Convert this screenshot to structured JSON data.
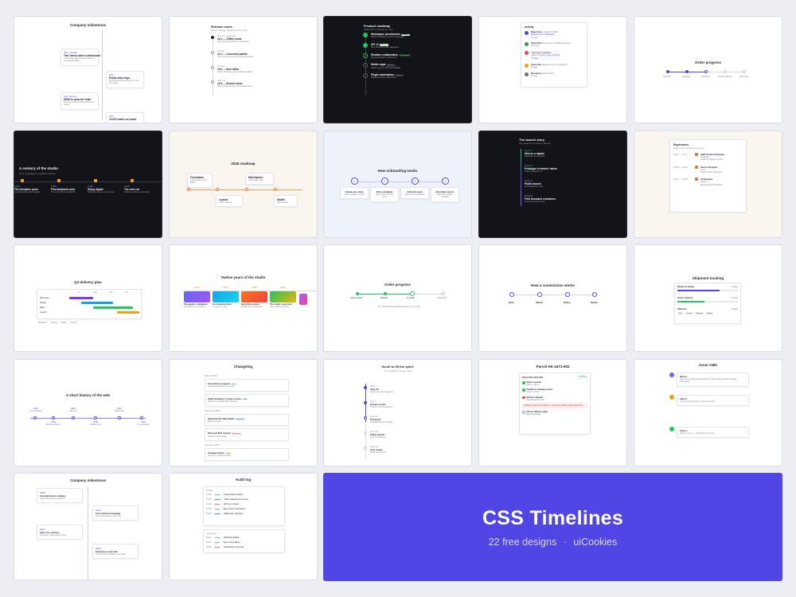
{
  "cards": {
    "c1": {
      "title": "Company milestones",
      "items": [
        {
          "date": "2014 · Founded",
          "title": "Two interns start a whiteboard",
          "text": "A notebook and a shared laptop in a borrowed office"
        },
        {
          "date": "2016",
          "title": "Public beta ships",
          "text": "Four thousand people join in the first week"
        },
        {
          "date": "2019 · Series A",
          "title": "$20M to grow the team",
          "text": "Opened our first office across the ocean"
        },
        {
          "date": "2023",
          "title": "10,000 teams on board",
          "text": "Customers in more than sixty countries"
        }
      ]
    },
    "c2": {
      "title": "Release notes",
      "sub": "Every change, shipped in the open",
      "items": [
        {
          "date": "Nov 12 · Release",
          "title": "v4.2 — Offline mode",
          "text": "Keep working without a connection"
        },
        {
          "date": "Oct 30",
          "title": "v4.1 — Command palette",
          "text": "Jump to any screen from the keyboard"
        },
        {
          "date": "Oct 02",
          "title": "v4.0 — New editor",
          "text": "Faster rendering and a cleaner toolbar"
        },
        {
          "date": "Sep 18",
          "title": "v3.9 — Shared views",
          "text": "Send a filtered view to the whole team"
        }
      ]
    },
    "c3": {
      "title": "Product roadmap",
      "sub": "What we're working on next",
      "items": [
        {
          "title": "Workspace permissions",
          "tag": "Shipped",
          "text": "Roles for editors, viewers and guests"
        },
        {
          "title": "API v2",
          "tag": "Shipped",
          "text": "New endpoints with pagination"
        },
        {
          "title": "Realtime collaboration",
          "tag": "In progress",
          "text": "See teammates' cursors live"
        },
        {
          "title": "Mobile apps",
          "tag": "Planned",
          "text": "Native apps for iOS and Android"
        },
        {
          "title": "Plugin marketplace",
          "tag": "Planned",
          "text": "Build and share integrations"
        }
      ]
    },
    "c4": {
      "title": "Activity",
      "items": [
        {
          "who": "Maya Chen",
          "what": "merged PR #482",
          "text": "Refactor auth middleware",
          "time": "2m ago"
        },
        {
          "who": "Omar Silva",
          "what": "commented on Billing redesign",
          "text": "",
          "time": "14m ago"
        },
        {
          "who": "",
          "what": "New bug in checkout",
          "text": "Payment button stays disabled",
          "time": "1h ago"
        },
        {
          "who": "Grace Kim",
          "what": "deployed v4.2 to production",
          "text": "",
          "time": "3h ago"
        },
        {
          "who": "Bot deploy",
          "what": "build passed",
          "text": "",
          "time": "5h ago"
        }
      ]
    },
    "c5": {
      "title": "Order progress",
      "steps": [
        "Ordered",
        "Shipping",
        "Delivered",
        "Out for delivery",
        "Returned"
      ]
    },
    "c6": {
      "title": "A century of the studio",
      "sub": "From a garage to a global practice",
      "items": [
        {
          "year": "1925",
          "title": "The formative years",
          "text": "A small drafting room opens"
        },
        {
          "year": "1955",
          "title": "First landmark work",
          "text": "The civic hall is completed"
        },
        {
          "year": "1990",
          "title": "Going digital",
          "text": "Drawings move to the screen"
        },
        {
          "year": "2025",
          "title": "The next era",
          "text": "Studios on three continents"
        }
      ]
    },
    "c7": {
      "title": "2026 roadmap",
      "items": [
        {
          "title": "Foundation",
          "text": "Core platform and billing"
        },
        {
          "title": "Launch",
          "text": "Public release"
        },
        {
          "title": "Marketplace",
          "text": "Third-party apps"
        },
        {
          "title": "Mobile",
          "text": "Native apps"
        }
      ]
    },
    "c8": {
      "title": "How onboarding works",
      "items": [
        {
          "n": "1",
          "title": "Create your team",
          "text": "Invite people by email"
        },
        {
          "n": "2",
          "title": "Pick a template",
          "text": "Start from a proven setup"
        },
        {
          "n": "3",
          "title": "Invite the team",
          "text": "Share the workspace"
        },
        {
          "n": "4",
          "title": "Automate reports",
          "text": "Schedule weekly updates"
        }
      ]
    },
    "c9": {
      "title": "The launch story",
      "sub": "Six weeks from idea to launch",
      "items": [
        {
          "date": "Week 1",
          "title": "Idea on a napkin",
          "text": "Sketched the first flow"
        },
        {
          "date": "Week 2",
          "title": "Prototype in testers' hands",
          "text": "Twenty people try it"
        },
        {
          "date": "Week 4",
          "title": "Public launch",
          "text": "Front page for a day"
        },
        {
          "date": "Week 6",
          "title": "First thousand customers",
          "text": "Revenue covers costs"
        }
      ]
    },
    "c10": {
      "title": "Experience",
      "sub": "Eight years building products",
      "items": [
        {
          "date": "2021 — Now",
          "title": "Staff Product Designer",
          "org": "Northwind",
          "text": "Leads the design system"
        },
        {
          "date": "2018 — 2021",
          "title": "Senior Designer",
          "org": "Acme",
          "text": "Shipped the mobile app"
        },
        {
          "date": "2016 — 2018",
          "title": "UI Designer",
          "org": "Globex",
          "text": "Redesigned onboarding"
        }
      ]
    },
    "c11": {
      "title": "Q3 delivery plan",
      "rows": [
        "Discovery",
        "Design",
        "Build",
        "Launch"
      ],
      "months": [
        "Jul",
        "Aug",
        "Sep",
        "Oct"
      ],
      "legend": [
        "Research",
        "Design",
        "Build",
        "Launch"
      ]
    },
    "c12": {
      "title": "Twelve years of the studio",
      "items": [
        {
          "year": "2014",
          "title": "The garden, reimagined",
          "text": "First public commission"
        },
        {
          "year": "2017",
          "title": "First national client",
          "text": "A museum wing"
        },
        {
          "year": "2020",
          "title": "Everything remote",
          "text": "Studio goes distributed"
        },
        {
          "year": "2023",
          "title": "The studio's new chief",
          "text": "New creative director"
        }
      ]
    },
    "c13": {
      "title": "Order progress",
      "steps": [
        "Order placed",
        "Packed",
        "In transit",
        "Delivered"
      ],
      "text": "Your order left our warehouse and is on its way."
    },
    "c14": {
      "title": "How a commission works",
      "steps": [
        "Brief",
        "Sketch",
        "Refine",
        "Deliver"
      ]
    },
    "c15": {
      "title": "Shipment tracking",
      "sections": [
        {
          "label": "Ready for pickup",
          "right": "Details"
        },
        {
          "label": "Out for delivery",
          "right": "Details"
        },
        {
          "label": "Delivered",
          "right": "Details"
        }
      ],
      "chips": [
        "Paid",
        "Packed",
        "Shipped",
        "Signed"
      ]
    },
    "c16": {
      "title": "A short history of the web",
      "items": [
        {
          "year": "1991",
          "title": "First website"
        },
        {
          "year": "1993",
          "title": "Mosaic browser"
        },
        {
          "year": "2004",
          "title": "Web 2.0"
        },
        {
          "year": "2008",
          "title": "Mobile web"
        },
        {
          "year": "2015",
          "title": "ES6 lands"
        },
        {
          "year": "2024",
          "title": "AI assistants"
        }
      ]
    },
    "c17": {
      "title": "Changelog",
      "items": [
        {
          "date": "March 2025",
          "title": "Scroll-driven progress",
          "tag": "New",
          "text": "Animate the rail as you scroll"
        },
        {
          "date": "",
          "title": "Sticky headings on large screens",
          "tag": "New",
          "text": "Dates stay pinned while reading"
        },
        {
          "date": "February 2025",
          "title": "Reworked the dark palette",
          "tag": "Improved",
          "text": "Better contrast"
        },
        {
          "date": "",
          "title": "Removed IE11 support",
          "tag": "Removed",
          "text": "Smaller CSS bundle"
        },
        {
          "date": "January 2025",
          "title": "Grouped entries",
          "tag": "Fixed",
          "text": "Group by month or week"
        }
      ]
    },
    "c18": {
      "title": "Scroll to fill the spine",
      "sub": "The rail fills in as you read",
      "items": [
        {
          "date": "Day 1",
          "title": "Kick-off",
          "text": "Goals and scope agreed"
        },
        {
          "date": "Day 5",
          "title": "Design system",
          "text": "Tokens and components"
        },
        {
          "date": "Day 12",
          "title": "Prototype",
          "text": "Clickable flow for testing"
        },
        {
          "date": "Day 20",
          "title": "Public launch",
          "text": "Live for everyone"
        },
        {
          "date": "Day 30",
          "title": "First review",
          "text": "What we learned"
        }
      ]
    },
    "c19": {
      "title": "Parcel HK-4471-902",
      "badge": "In transit",
      "items": [
        {
          "title": "Order received",
          "text": "Mar 3 · 09:14"
        },
        {
          "title": "Handed to shipping carrier",
          "text": "Mar 3 · 16:02"
        },
        {
          "title": "Delivery delayed",
          "text": "Weather at the hub"
        },
        {
          "title": "Out for delivery again",
          "text": "Expected today"
        }
      ],
      "alert": "Address could not be found — the carrier will try again tomorrow."
    },
    "c20": {
      "title": "Issue #482",
      "items": [
        {
          "who": "Maya K",
          "text": "The export button breaks when the file name contains unicode characters."
        },
        {
          "who": "Omar S",
          "text": "I can reproduce this on the latest build."
        },
        {
          "who": "Grace L",
          "text": "Fixed in v4.2.1 — thanks for the report."
        }
      ]
    },
    "c21": {
      "title": "Company milestones",
      "items": [
        {
          "date": "2008",
          "title": "Founded above a bakery",
          "text": "Three friends and one idea"
        },
        {
          "date": "2012",
          "title": "First national campaign",
          "text": "Our work reaches every city"
        },
        {
          "date": "2017",
          "title": "Sixty-one sections",
          "text": "The team grows across floors"
        },
        {
          "date": "2022",
          "title": "Employee ownership",
          "text": "The company belongs to its staff"
        }
      ]
    },
    "c22": {
      "title": "Audit log",
      "groups": [
        "Today",
        "Yesterday"
      ],
      "rows": [
        {
          "time": "14:02",
          "level": "Create",
          "text": "Project Atlas created"
        },
        {
          "time": "13:47",
          "level": "Update",
          "text": "Roles changed for 3 users"
        },
        {
          "time": "13:12",
          "level": "Delete",
          "text": "API key revoked"
        },
        {
          "time": "12:40",
          "level": "Login",
          "text": "Sign-in from new device"
        },
        {
          "time": "11:05",
          "level": "Update",
          "text": "Billing plan changed"
        },
        {
          "time": "18:22",
          "level": "Create",
          "text": "Webhook added"
        },
        {
          "time": "16:09",
          "level": "Login",
          "text": "Sign-in from Berlin"
        },
        {
          "time": "09:31",
          "level": "Delete",
          "text": "Old backups removed"
        }
      ]
    }
  },
  "hero": {
    "title": "CSS Timelines",
    "subtitle": "22 free designs",
    "separator": "·",
    "brand": "uiCookies"
  },
  "colors": {
    "accent": "#4f46e5",
    "hero_bg": "#4f46e5",
    "green": "#2f9a52",
    "orange": "#f59e0b",
    "red": "#e0524b"
  }
}
